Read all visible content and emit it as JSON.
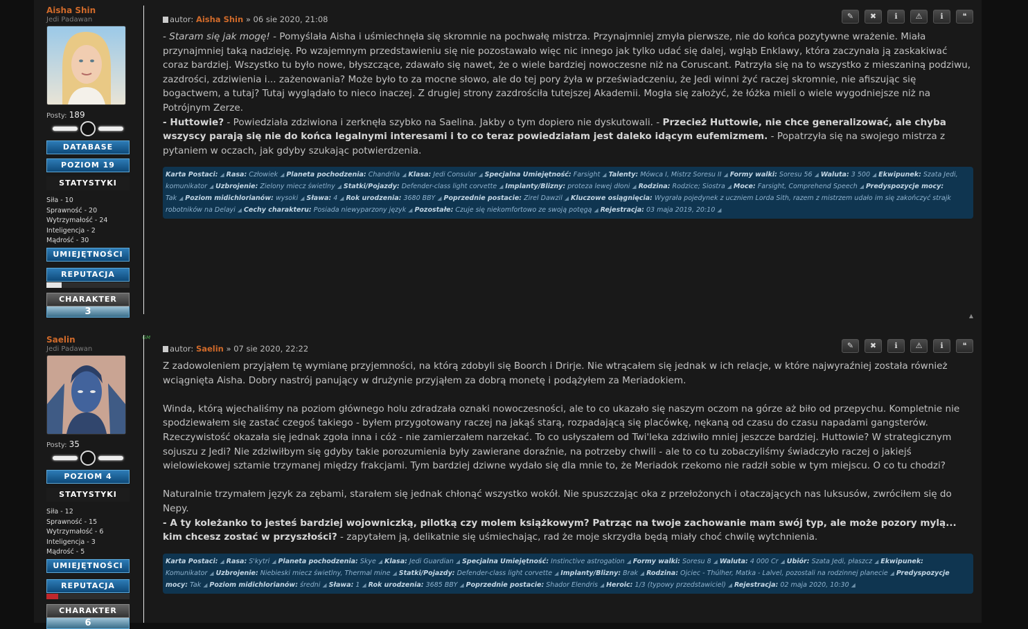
{
  "posts": [
    {
      "author": "Aisha Shin",
      "rank": "Jedi Padawan",
      "posts_label": "Posty:",
      "posts_count": "189",
      "buttons": {
        "database": "DATABASE",
        "level": "POZIOM 19",
        "stats": "STATYSTYKI",
        "skills": "UMIEJĘTNOŚCI",
        "reputation": "REPUTACJA",
        "character": "CHARAKTER"
      },
      "character_value": "3",
      "reputation_fraction": 0.18,
      "reputation_color": "#e6e6e6",
      "attributes": [
        "Siła - 10",
        "Sprawność - 20",
        "Wytrzymałość - 24",
        "Inteligencja - 2",
        "Mądrość - 30"
      ],
      "header": {
        "prefix": "autor:",
        "author": "Aisha Shin",
        "date": "» 06 sie 2020, 21:08"
      },
      "body": [
        {
          "t": "i",
          "v": "- Staram się jak mogę!"
        },
        {
          "t": "n",
          "v": " - Pomyślała Aisha i uśmiechnęła się skromnie na pochwałę mistrza. Przynajmniej zmyła pierwsze, nie do końca pozytywne wrażenie. Miała przynajmniej taką nadzieję. Po wzajemnym przedstawieniu się nie pozostawało więc nic innego jak tylko udać się dalej, wgłąb Enklawy, która zaczynała ją zaskakiwać coraz bardziej. Wszystko tu było nowe, błyszczące, zdawało się nawet, że o wiele bardziej nowoczesne niż na Coruscant. Patrzyła się na to wszystko z mieszaniną podziwu, zazdrości, zdziwienia i... zażenowania? Może było to za mocne słowo, ale do tej pory żyła w przeświadczeniu, że Jedi winni żyć raczej skromnie, nie afiszując się bogactwem, a tutaj? Tutaj wyglądało to nieco inaczej. Z drugiej strony zazdrościła tutejszej Akademii. Mogła się założyć, że łóżka mieli o wiele wygodniejsze niż na Potrójnym Zerze."
        },
        {
          "t": "br"
        },
        {
          "t": "b",
          "v": "- Huttowie?"
        },
        {
          "t": "n",
          "v": " - Powiedziała zdziwiona i zerknęła szybko na Saelina. Jakby o tym dopiero nie dyskutowali. - "
        },
        {
          "t": "b",
          "v": "Przecież Huttowie, nie chce generalizować, ale chyba wszyscy parają się nie do końca legalnymi interesami i to co teraz powiedziałam jest daleko idącym eufemizmem."
        },
        {
          "t": "n",
          "v": " - Popatrzyła się na swojego mistrza z pytaniem w oczach, jak gdyby szukając potwierdzenia."
        }
      ],
      "sheet": [
        {
          "k": "Karta Postaci:",
          "v": ""
        },
        {
          "k": "Rasa:",
          "v": "Człowiek"
        },
        {
          "k": "Planeta pochodzenia:",
          "v": "Chandrila"
        },
        {
          "k": "Klasa:",
          "v": "Jedi Consular"
        },
        {
          "k": "Specjalna Umiejętność:",
          "v": "Farsight"
        },
        {
          "k": "Talenty:",
          "v": "Mówca I, Mistrz Soresu II"
        },
        {
          "k": "Formy walki:",
          "v": "Soresu 56"
        },
        {
          "k": "Waluta:",
          "v": "3 500"
        },
        {
          "k": "Ekwipunek:",
          "v": "Szata Jedi, komunikator"
        },
        {
          "k": "Uzbrojenie:",
          "v": "Zielony miecz świetlny"
        },
        {
          "k": "Statki/Pojazdy:",
          "v": "Defender-class light corvette"
        },
        {
          "k": "Implanty/Blizny:",
          "v": "proteza lewej dłoni"
        },
        {
          "k": "Rodzina:",
          "v": "Rodzice; Siostra"
        },
        {
          "k": "Moce:",
          "v": "Farsight, Comprehend Speech"
        },
        {
          "k": "Predyspozycje mocy:",
          "v": "Tak"
        },
        {
          "k": "Poziom midichlorianów:",
          "v": "wysoki"
        },
        {
          "k": "Sława:",
          "v": "4"
        },
        {
          "k": "Rok urodzenia:",
          "v": "3680 BBY"
        },
        {
          "k": "Poprzednie postacie:",
          "v": "Zirel Dawzil"
        },
        {
          "k": "Kluczowe osiągnięcia:",
          "v": "Wygrała pojedynek z uczniem Lorda Sith, razem z mistrzem udało im się zakończyć strajk robotników na Delayi"
        },
        {
          "k": "Cechy charakteru:",
          "v": "Posiada niewyparzony język"
        },
        {
          "k": "Pozostałe:",
          "v": "Czuje się niekomfortowo ze swoją potęgą"
        },
        {
          "k": "Rejestracja:",
          "v": "03 maja 2019, 20:10"
        }
      ]
    },
    {
      "author": "Saelin",
      "rank": "Jedi Padawan",
      "badge": "GM",
      "posts_label": "Posty:",
      "posts_count": "35",
      "buttons": {
        "level": "POZIOM 4",
        "stats": "STATYSTYKI",
        "skills": "UMIEJĘTNOŚCI",
        "reputation": "REPUTACJA",
        "character": "CHARAKTER"
      },
      "character_value": "6",
      "reputation_fraction": 0.14,
      "reputation_color": "#c0282d",
      "attributes": [
        "Siła - 12",
        "Sprawność - 15",
        "Wytrzymałość - 6",
        "Inteligencja - 3",
        "Mądrość - 5"
      ],
      "header": {
        "prefix": "autor:",
        "author": "Saelin",
        "date": "» 07 sie 2020, 22:22"
      },
      "body": [
        {
          "t": "n",
          "v": "Z zadowoleniem przyjąłem tę wymianę przyjemności, na którą zdobyli się Boorch i Drirje. Nie wtrącałem się jednak w ich relacje, w które najwyraźniej została również wciągnięta Aisha. Dobry nastrój panujący w drużynie przyjąłem za dobrą monetę i podążyłem za Meriadokiem."
        },
        {
          "t": "p"
        },
        {
          "t": "n",
          "v": "Winda, którą wjechaliśmy na poziom głównego holu zdradzała oznaki nowoczesności, ale to co ukazało się naszym oczom na górze aż biło od przepychu. Kompletnie nie spodziewałem się zastać czegoś takiego - byłem przygotowany raczej na jakąś starą, rozpadającą się placówkę, nękaną od czasu do czasu napadami gangsterów. Rzeczywistość okazała się jednak zgoła inna i cóż - nie zamierzałem narzekać. To co usłyszałem od Twi'leka zdziwiło mniej jeszcze bardziej. Huttowie? W strategicznym sojuszu z Jedi? Nie zdziwiłbym się gdyby takie porozumienia były zawierane doraźnie, na potrzeby chwili - ale to co tu zobaczyliśmy świadczyło raczej o jakiejś wielowiekowej sztamie trzymanej między frakcjami. Tym bardziej dziwne wydało się dla mnie to, że Meriadok rzekomo nie radził sobie w tym miejscu. O co tu chodzi?"
        },
        {
          "t": "p"
        },
        {
          "t": "n",
          "v": "Naturalnie trzymałem język za zębami, starałem się jednak chłonąć wszystko wokół. Nie spuszczając oka z przełożonych i otaczających nas luksusów, zwróciłem się do Nepy."
        },
        {
          "t": "br"
        },
        {
          "t": "b",
          "v": "- A ty koleżanko to jesteś bardziej wojowniczką, pilotką czy molem książkowym? Patrząc na twoje zachowanie mam swój typ, ale może pozory mylą... kim chcesz zostać w przyszłości?"
        },
        {
          "t": "n",
          "v": " - zapytałem ją, delikatnie się uśmiechając, rad że moje skrzydła będą miały choć chwilę wytchnienia."
        }
      ],
      "sheet": [
        {
          "k": "Karta Postaci:",
          "v": ""
        },
        {
          "k": "Rasa:",
          "v": "S'kytri"
        },
        {
          "k": "Planeta pochodzenia:",
          "v": "Skye"
        },
        {
          "k": "Klasa:",
          "v": "Jedi Guardian"
        },
        {
          "k": "Specjalna Umiejętność:",
          "v": "Instinctive astrogation"
        },
        {
          "k": "Formy walki:",
          "v": "Soresu 8"
        },
        {
          "k": "Waluta:",
          "v": "4 000 Cr"
        },
        {
          "k": "Ubiór:",
          "v": "Szata Jedi, płaszcz"
        },
        {
          "k": "Ekwipunek:",
          "v": "Komunikator"
        },
        {
          "k": "Uzbrojenie:",
          "v": "Niebieski miecz świetlny, Thermal mine"
        },
        {
          "k": "Statki/Pojazdy:",
          "v": "Defender-class light corvette"
        },
        {
          "k": "Implanty/Blizny:",
          "v": "Brak"
        },
        {
          "k": "Rodzina:",
          "v": "Ojciec - Thúlher, Matka - Lalvel, pozostali na rodzinnej planecie"
        },
        {
          "k": "Predyspozycje mocy:",
          "v": "Tak"
        },
        {
          "k": "Poziom midichlorianów:",
          "v": "średni"
        },
        {
          "k": "Sława:",
          "v": "1"
        },
        {
          "k": "Rok urodzenia:",
          "v": "3685 BBY"
        },
        {
          "k": "Poprzednie postacie:",
          "v": "Shador Elendris"
        },
        {
          "k": "Heroic:",
          "v": "1/3 (typowy przedstawiciel)"
        },
        {
          "k": "Rejestracja:",
          "v": "02 maja 2020, 10:30"
        }
      ]
    }
  ],
  "post_icons": [
    {
      "name": "edit-icon",
      "glyph": "✎"
    },
    {
      "name": "delete-icon",
      "glyph": "✖"
    },
    {
      "name": "info-icon",
      "glyph": "ℹ"
    },
    {
      "name": "report-icon",
      "glyph": "⚠"
    },
    {
      "name": "warn-icon",
      "glyph": "ℹ"
    },
    {
      "name": "quote-icon",
      "glyph": "❝"
    }
  ],
  "colors": {
    "author": "#d06a2a",
    "sheet_bg": "#0f3550",
    "button_blue": "#1e6aa2"
  },
  "top_icon": "▲"
}
